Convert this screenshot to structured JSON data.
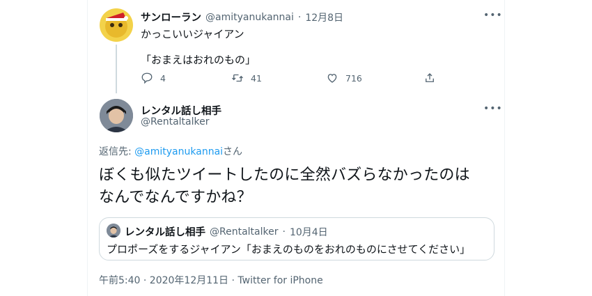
{
  "reply_to_tweet": {
    "display_name": "サンローラン",
    "handle": "@amityanukannai",
    "separator": "·",
    "date": "12月8日",
    "text_line1": "かっこいいジャイアン",
    "text_line2": "「おまえはおれのもの」",
    "reply_count": "4",
    "retweet_count": "41",
    "like_count": "716"
  },
  "main_tweet": {
    "display_name": "レンタル話し相手",
    "handle": "@Rentaltalker",
    "replying_prefix": "返信先: ",
    "replying_handle": "@amityanukannai",
    "replying_suffix": "さん",
    "text_line1": "ぼくも似たツイートしたのに全然バズらなかったのは",
    "text_line2": "なんでなんですかね？",
    "timestamp": "午前5:40 · 2020年12月11日 · Twitter for iPhone"
  },
  "quoted_tweet": {
    "display_name": "レンタル話し相手",
    "handle": "@Rentaltalker",
    "separator": "·",
    "date": "10月4日",
    "text": "プロポーズをするジャイアン「おまえのものをおれのものにさせてください」"
  },
  "colors": {
    "link": "#1d9bf0",
    "secondary_text": "#536471",
    "border": "#cfd9de"
  }
}
